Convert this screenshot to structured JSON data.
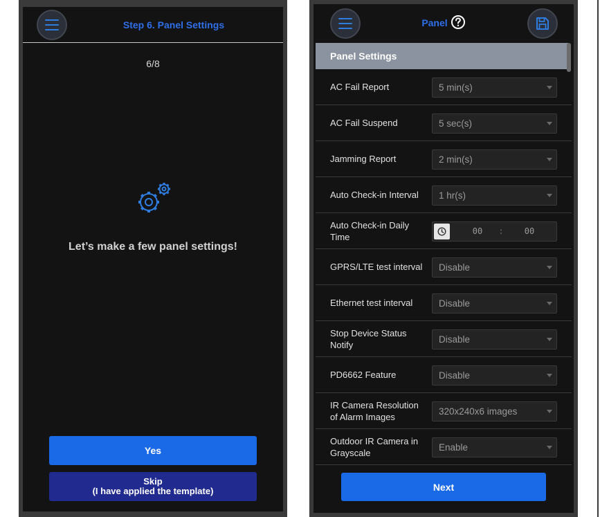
{
  "wizard": {
    "header_title": "Step 6. Panel Settings",
    "step_count": "6/8",
    "welcome_text": "Let’s make a few panel settings!",
    "yes_label": "Yes",
    "skip_line1": "Skip",
    "skip_line2": "(I have applied the template)",
    "icons": {
      "menu": "hamburger-menu-icon",
      "illustration": "gears-icon"
    }
  },
  "panel": {
    "header_title": "Panel",
    "section_title": "Panel Settings",
    "next_label": "Next",
    "icons": {
      "menu": "hamburger-menu-icon",
      "help": "help-circle-icon",
      "save": "floppy-disk-icon",
      "clock": "clock-icon"
    },
    "settings": [
      {
        "label": "AC Fail Report",
        "value": "5 min(s)"
      },
      {
        "label": "AC Fail Suspend",
        "value": "5 sec(s)"
      },
      {
        "label": "Jamming Report",
        "value": "2 min(s)"
      },
      {
        "label": "Auto Check-in Interval",
        "value": "1 hr(s)"
      },
      {
        "label": "Auto Check-in Daily Time",
        "hour": "00",
        "separator": ":",
        "minute": "00"
      },
      {
        "label": "GPRS/LTE test interval",
        "value": "Disable"
      },
      {
        "label": "Ethernet test interval",
        "value": "Disable"
      },
      {
        "label": "Stop Device Status Notify",
        "value": "Disable"
      },
      {
        "label": "PD6662 Feature",
        "value": "Disable"
      },
      {
        "label": "IR Camera Resolution of Alarm Images",
        "value": "320x240x6 images"
      },
      {
        "label": "Outdoor IR Camera in Grayscale",
        "value": "Enable"
      }
    ]
  },
  "colors": {
    "accent_blue": "#1a6ae8",
    "title_blue": "#2f6fe8",
    "skip_button": "#212b8f",
    "section_header": "#8a939f",
    "background": "#131313"
  }
}
